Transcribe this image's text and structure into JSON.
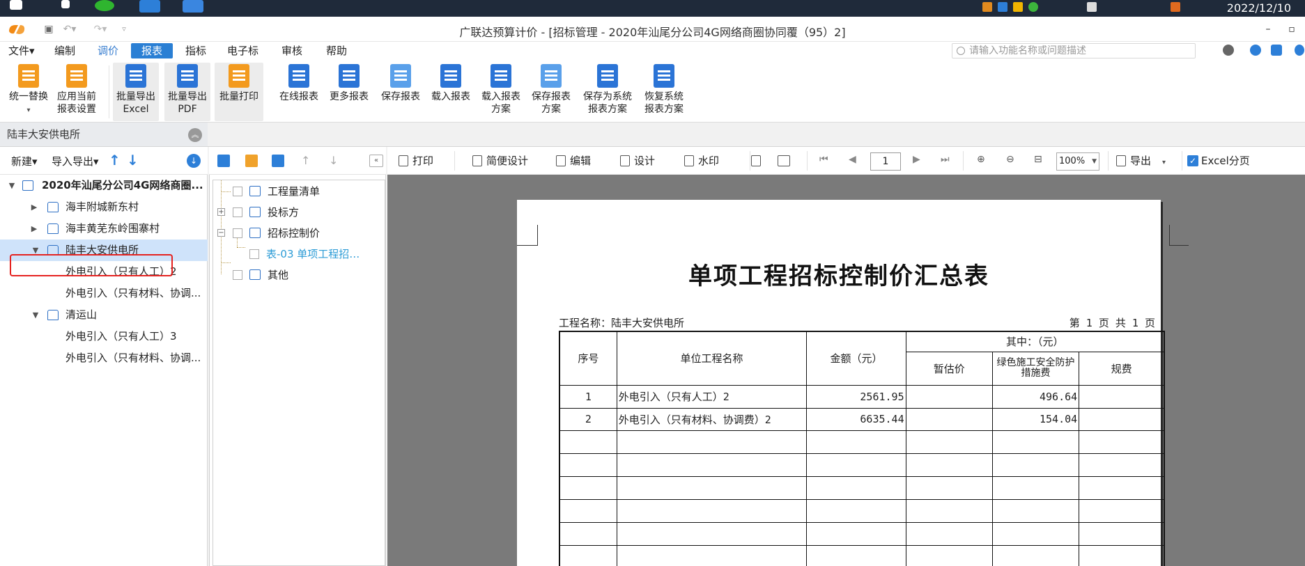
{
  "taskbar": {
    "date": "2022/12/10"
  },
  "window": {
    "title": "广联达预算计价 - [招标管理 - 2020年汕尾分公司4G网络商圈协同覆（95）2]"
  },
  "menu": {
    "items": [
      {
        "label": "文件▾"
      },
      {
        "label": "编制"
      },
      {
        "label": "调价"
      },
      {
        "label": "报表"
      },
      {
        "label": "指标"
      },
      {
        "label": "电子标"
      },
      {
        "label": "审核"
      },
      {
        "label": "帮助"
      }
    ],
    "search_placeholder": "请输入功能名称或问题描述"
  },
  "ribbon": {
    "buttons": [
      {
        "label": "统一替换"
      },
      {
        "label": "应用当前 报表设置"
      },
      {
        "label": "批量导出 Excel"
      },
      {
        "label": "批量导出 PDF"
      },
      {
        "label": "批量打印"
      },
      {
        "label": "在线报表"
      },
      {
        "label": "更多报表"
      },
      {
        "label": "保存报表"
      },
      {
        "label": "载入报表"
      },
      {
        "label": "载入报表 方案"
      },
      {
        "label": "保存报表 方案"
      },
      {
        "label": "保存为系统 报表方案"
      },
      {
        "label": "恢复系统 报表方案"
      }
    ],
    "colors": {
      "orange": "#f39a1e",
      "blue": "#2b74d6"
    }
  },
  "left_panel": {
    "header": "陆丰大安供电所",
    "tools": {
      "new": "新建▾",
      "import_export": "导入导出▾"
    },
    "tree": [
      {
        "label": "2020年汕尾分公司4G网络商圈..."
      },
      {
        "label": "海丰附城新东村"
      },
      {
        "label": "海丰黄芜东岭围寨村"
      },
      {
        "label": "陆丰大安供电所"
      },
      {
        "label": "外电引入（只有人工）2"
      },
      {
        "label": "外电引入（只有材料、协调..."
      },
      {
        "label": "清运山"
      },
      {
        "label": "外电引入（只有人工）3"
      },
      {
        "label": "外电引入（只有材料、协调..."
      }
    ]
  },
  "mid_panel": {
    "items": [
      {
        "label": "工程量清单"
      },
      {
        "label": "投标方"
      },
      {
        "label": "招标控制价"
      },
      {
        "label": "表-03 单项工程招…"
      },
      {
        "label": "其他"
      }
    ]
  },
  "report_toolbar": {
    "print": "打印",
    "simple_design": "简便设计",
    "edit": "编辑",
    "design": "设计",
    "watermark": "水印",
    "page": "1",
    "zoom": "100%",
    "export": "导出",
    "excel_paging": "Excel分页"
  },
  "report": {
    "title": "单项工程招标控制价汇总表",
    "project_name": "工程名称：陆丰大安供电所",
    "page_info": "第 1 页 共 1 页",
    "headers": {
      "seq": "序号",
      "unit_name": "单位工程名称",
      "amount": "金额（元）",
      "among": "其中：（元）",
      "provisional": "暂估价",
      "green": "绿色施工安全防护措施费",
      "fee": "规费"
    },
    "rows": [
      {
        "seq": "1",
        "name": "外电引入（只有人工）2",
        "amount": "2561.95",
        "provisional": "",
        "green": "496.64",
        "fee": ""
      },
      {
        "seq": "2",
        "name": "外电引入（只有材料、协调费）2",
        "amount": "6635.44",
        "provisional": "",
        "green": "154.04",
        "fee": ""
      }
    ]
  }
}
